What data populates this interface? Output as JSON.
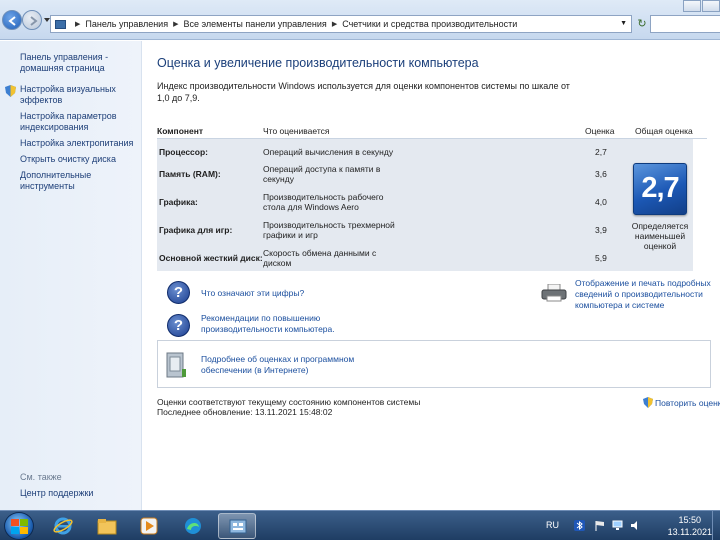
{
  "breadcrumb": [
    "Панель управления",
    "Все элементы панели управления",
    "Счетчики и средства производительности"
  ],
  "sidebar": {
    "home": "Панель управления -\nдомашняя страница",
    "items": [
      "Настройка визуальных\nэффектов",
      "Настройка параметров\nиндексирования",
      "Настройка электропитания",
      "Открыть очистку диска",
      "Дополнительные\nинструменты"
    ],
    "see_also": "См. также",
    "support": "Центр поддержки"
  },
  "page": {
    "title": "Оценка и увеличение производительности компьютера",
    "description": "Индекс производительности Windows используется для оценки компонентов системы по шкале от 1,0 до 7,9."
  },
  "table": {
    "headers": {
      "component": "Компонент",
      "what": "Что оценивается",
      "score": "Оценка",
      "overall": "Общая оценка"
    },
    "rows": [
      {
        "component": "Процессор:",
        "what": "Операций вычисления в секунду",
        "score": "2,7"
      },
      {
        "component": "Память (RAM):",
        "what": "Операций доступа к памяти в секунду",
        "score": "3,6"
      },
      {
        "component": "Графика:",
        "what": "Производительность рабочего стола для Windows Aero",
        "score": "4,0"
      },
      {
        "component": "Графика для игр:",
        "what": "Производительность трехмерной графики и игр",
        "score": "3,9"
      },
      {
        "component": "Основной жесткий диск:",
        "what": "Скорость обмена данными с диском",
        "score": "5,9"
      }
    ],
    "overall_score": "2,7",
    "overall_note": "Определяется наименьшей оценкой"
  },
  "links": {
    "what_numbers": "Что означают эти цифры?",
    "recommendations": "Рекомендации по повышению производительности компьютера.",
    "print": "Отображение и печать подробных сведений о производительности компьютера и системе",
    "online": "Подробнее об оценках и программном обеспечении (в Интернете)"
  },
  "status": {
    "line1": "Оценки соответствуют текущему состоянию компонентов системы",
    "line2": "Последнее обновление: 13.11.2021 15:48:02",
    "rerun": "Повторить оценку"
  },
  "taskbar": {
    "lang": "RU",
    "time": "15:50",
    "date": "13.11.2021"
  },
  "colors": {
    "link": "#1a4e9e",
    "title": "#1b3f7a",
    "score_tile": "#1c58b5"
  }
}
